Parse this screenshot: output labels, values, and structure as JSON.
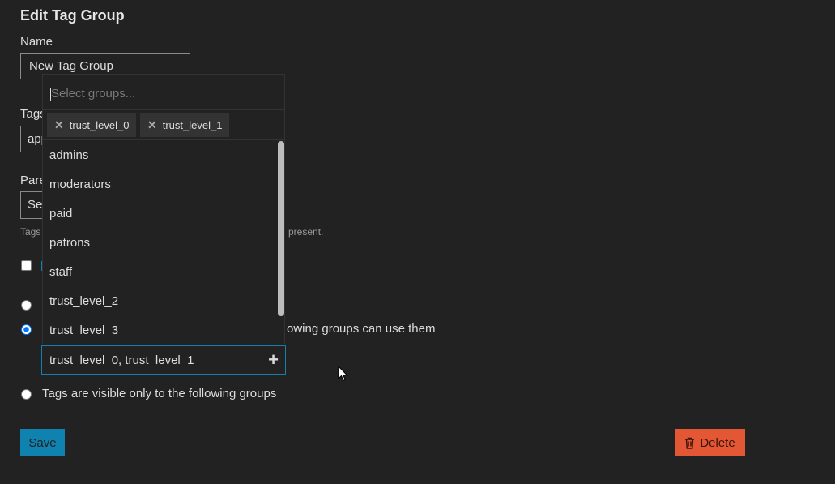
{
  "page": {
    "title": "Edit Tag Group"
  },
  "form": {
    "name_label": "Name",
    "name_value": "New Tag Group",
    "tags_label_visible": "Tags",
    "tags_value_visible": "app",
    "parent_label_visible": "Pare",
    "parent_value_visible": "Se",
    "parent_help_left": "Tags",
    "parent_help_right": "present.",
    "permission_visible_text": "owing groups can use them",
    "permission_visible_only_label": "Tags are visible only to the following groups"
  },
  "group_picker": {
    "filter_placeholder": "Select groups...",
    "selected_chips": [
      "trust_level_0",
      "trust_level_1"
    ],
    "options": [
      "admins",
      "moderators",
      "paid",
      "patrons",
      "staff",
      "trust_level_2",
      "trust_level_3"
    ],
    "selected_summary": "trust_level_0, trust_level_1"
  },
  "actions": {
    "save_label": "Save",
    "delete_label": "Delete"
  },
  "colors": {
    "primary": "#0f82af",
    "danger": "#e45735",
    "background": "#222222"
  },
  "icons": {
    "chip_remove": "close-icon",
    "add": "plus-icon",
    "delete": "trash-icon"
  }
}
